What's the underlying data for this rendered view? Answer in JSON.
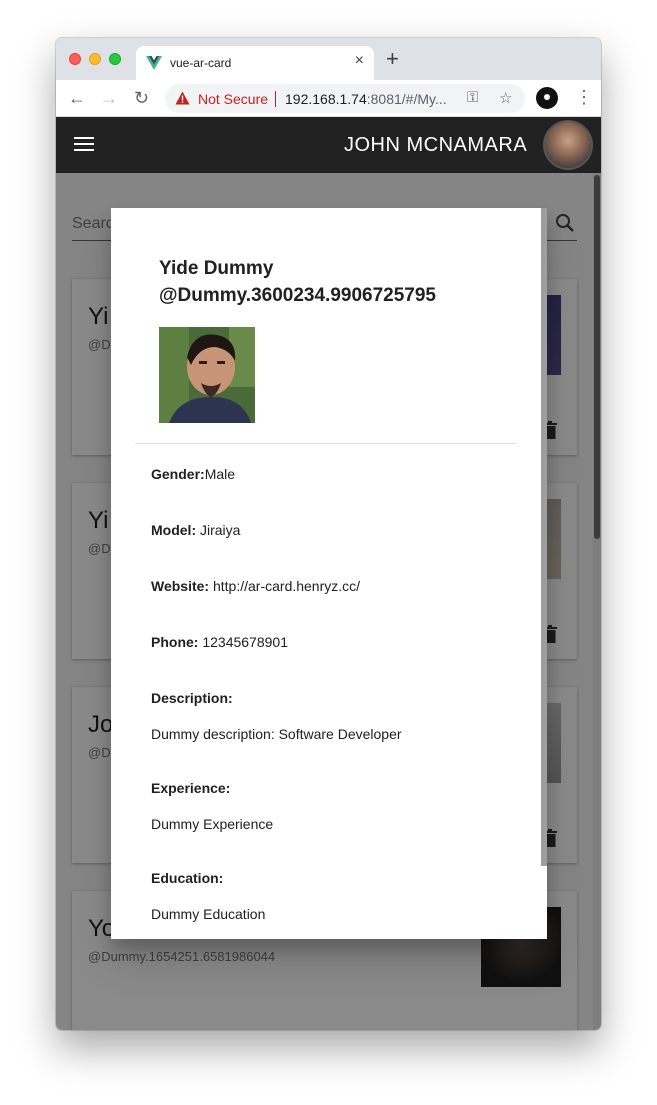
{
  "browser": {
    "tab_title": "vue-ar-card",
    "tab_close": "×",
    "new_tab": "+",
    "security_label": "Not Secure",
    "url_host": "192.168.1.74",
    "url_rest": ":8081/#/My...",
    "back": "←",
    "forward": "→",
    "reload": "↻",
    "key_icon": "⚿",
    "star_icon": "☆",
    "menu": "⋮"
  },
  "appbar": {
    "user_name": "JOHN MCNAMARA"
  },
  "search": {
    "placeholder": "Search"
  },
  "cards": [
    {
      "name": "Yi",
      "handle": "@Du"
    },
    {
      "name": "Yi",
      "handle": "@Du"
    },
    {
      "name": "Jo",
      "handle": "@Du"
    },
    {
      "name": "Yo",
      "handle": "@Dummy.1654251.6581986044"
    }
  ],
  "dialog": {
    "name": "Yide Dummy",
    "handle": "@Dummy.3600234.9906725795",
    "gender_label": "Gender:",
    "gender_value": "Male",
    "model_label": "Model:",
    "model_value": "Jiraiya",
    "website_label": "Website:",
    "website_value": "http://ar-card.henryz.cc/",
    "phone_label": "Phone:",
    "phone_value": "12345678901",
    "description_label": "Description:",
    "description_value": "Dummy description: Software Developer",
    "experience_label": "Experience:",
    "experience_value": "Dummy Experience",
    "education_label": "Education:",
    "education_value": "Dummy Education"
  },
  "colors": {
    "appbar": "#212121",
    "not_secure": "#c5221f",
    "overlay": "rgba(0,0,0,0.46)"
  }
}
